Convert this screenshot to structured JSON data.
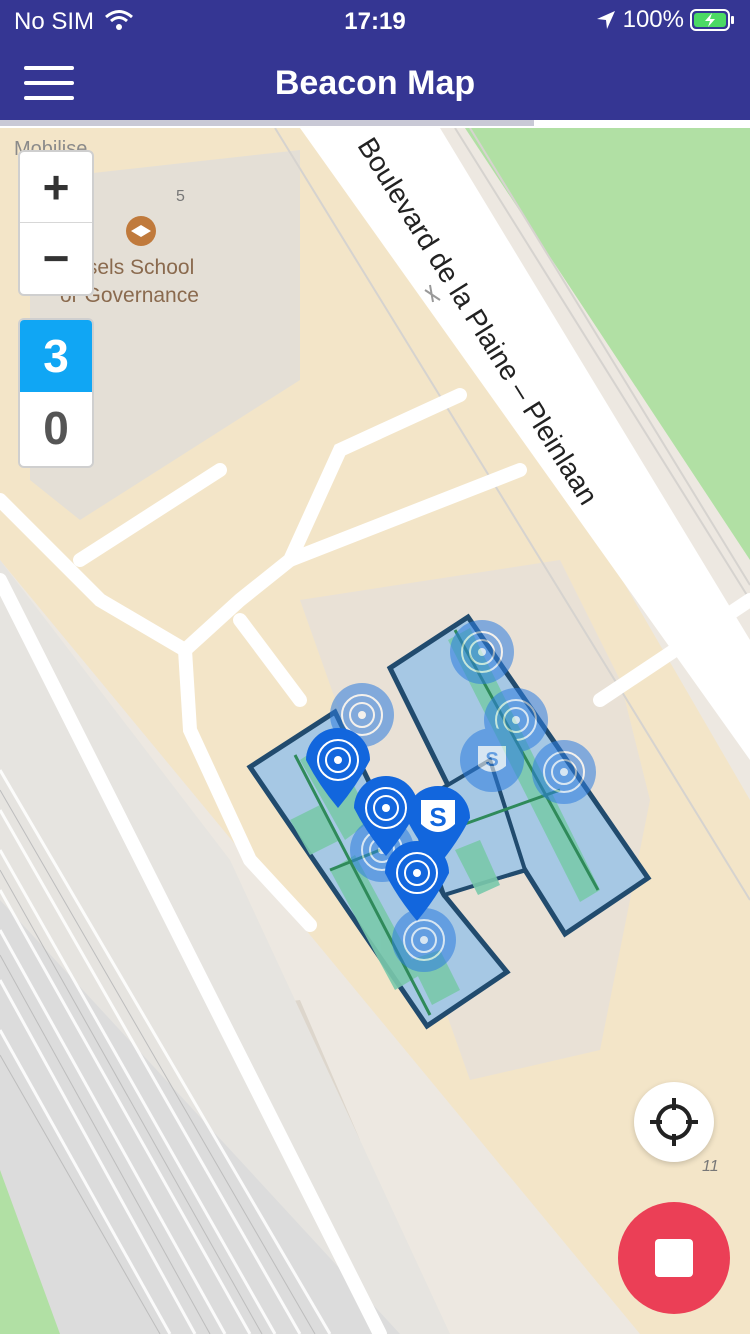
{
  "status_bar": {
    "carrier": "No SIM",
    "time": "17:19",
    "battery": "100%"
  },
  "header": {
    "title": "Beacon Map"
  },
  "map": {
    "street_label": "Boulevard de la Plaine – Pleinlaan",
    "poi_label_line1": "ussels School",
    "poi_label_line2": "or Governance",
    "cropped_label": "Mobilise",
    "number_label": "5",
    "zoom_level_label": "11"
  },
  "zoom_controls": {
    "in_label": "+",
    "out_label": "−"
  },
  "floor_selector": {
    "floors": [
      "3",
      "0"
    ],
    "active_floor": "3"
  },
  "colors": {
    "header": "#353693",
    "active_floor": "#10a6f4",
    "stop_button": "#eb3f56",
    "beacon_pin": "#1266dd"
  }
}
